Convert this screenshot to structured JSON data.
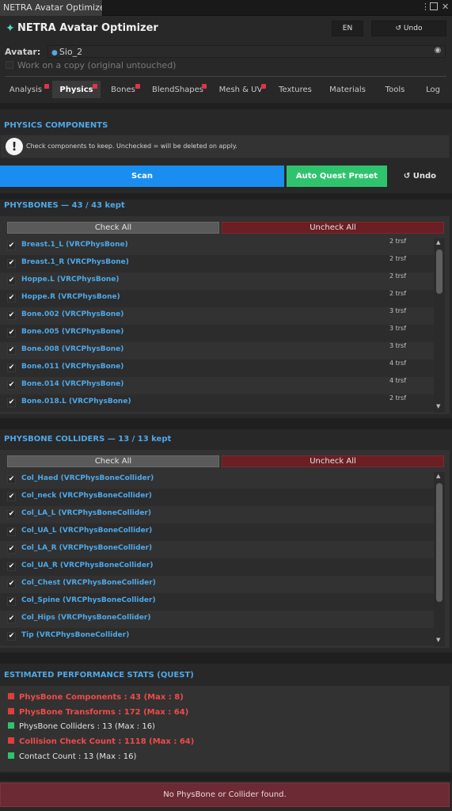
{
  "window": {
    "tab_title": "NETRA Avatar Optimizer"
  },
  "header": {
    "title": "NETRA Avatar Optimizer",
    "lang_label": "EN",
    "undo_label": "↺ Undo"
  },
  "avatar": {
    "label": "Avatar:",
    "value": "Sio_2",
    "copy_label": "Work on a copy (original untouched)"
  },
  "tabs": [
    {
      "label": "Analysis",
      "badge": true
    },
    {
      "label": "Physics",
      "badge": true,
      "active": true
    },
    {
      "label": "Bones",
      "badge": true
    },
    {
      "label": "BlendShapes",
      "badge": true
    },
    {
      "label": "Mesh & UV",
      "badge": true
    },
    {
      "label": "Textures",
      "badge": false
    },
    {
      "label": "Materials",
      "badge": false
    },
    {
      "label": "Tools",
      "badge": false
    },
    {
      "label": "Log",
      "badge": false
    }
  ],
  "physics": {
    "section_title": "PHYSICS COMPONENTS",
    "info_text": "Check components to keep. Unchecked = will be deleted on apply.",
    "scan_label": "Scan",
    "quest_label": "Auto Quest Preset",
    "undo_label": "↺ Undo"
  },
  "physbones": {
    "title": "PHYSBONES — 43 / 43 kept",
    "check_all": "Check All",
    "uncheck_all": "Uncheck All",
    "items": [
      {
        "label": "Breast.1_L  (VRCPhysBone)",
        "count": "2 trsf"
      },
      {
        "label": "Breast.1_R  (VRCPhysBone)",
        "count": "2 trsf"
      },
      {
        "label": "Hoppe.L  (VRCPhysBone)",
        "count": "2 trsf"
      },
      {
        "label": "Hoppe.R  (VRCPhysBone)",
        "count": "2 trsf"
      },
      {
        "label": "Bone.002  (VRCPhysBone)",
        "count": "3 trsf"
      },
      {
        "label": "Bone.005  (VRCPhysBone)",
        "count": "3 trsf"
      },
      {
        "label": "Bone.008  (VRCPhysBone)",
        "count": "3 trsf"
      },
      {
        "label": "Bone.011  (VRCPhysBone)",
        "count": "4 trsf"
      },
      {
        "label": "Bone.014  (VRCPhysBone)",
        "count": "4 trsf"
      },
      {
        "label": "Bone.018.L  (VRCPhysBone)",
        "count": "2 trsf"
      }
    ]
  },
  "colliders": {
    "title": "PHYSBONE COLLIDERS — 13 / 13 kept",
    "check_all": "Check All",
    "uncheck_all": "Uncheck All",
    "items": [
      {
        "label": "Col_Haed  (VRCPhysBoneCollider)"
      },
      {
        "label": "Col_neck  (VRCPhysBoneCollider)"
      },
      {
        "label": "Col_LA_L  (VRCPhysBoneCollider)"
      },
      {
        "label": "Col_UA_L  (VRCPhysBoneCollider)"
      },
      {
        "label": "Col_LA_R  (VRCPhysBoneCollider)"
      },
      {
        "label": "Col_UA_R  (VRCPhysBoneCollider)"
      },
      {
        "label": "Col_Chest  (VRCPhysBoneCollider)"
      },
      {
        "label": "Col_Spine  (VRCPhysBoneCollider)"
      },
      {
        "label": "Col_Hips  (VRCPhysBoneCollider)"
      },
      {
        "label": "Tip  (VRCPhysBoneCollider)"
      }
    ]
  },
  "stats": {
    "title": "ESTIMATED PERFORMANCE STATS (QUEST)",
    "items": [
      {
        "text": "PhysBone Components : 43  (Max : 8)",
        "status": "bad"
      },
      {
        "text": "PhysBone Transforms : 172  (Max : 64)",
        "status": "bad"
      },
      {
        "text": "PhysBone Colliders : 13  (Max : 16)",
        "status": "ok"
      },
      {
        "text": "Collision Check Count : 1118  (Max : 64)",
        "status": "bad"
      },
      {
        "text": "Contact Count : 13  (Max : 16)",
        "status": "ok"
      }
    ],
    "bad_color": "#e23c3c",
    "ok_color": "#2fc36e"
  },
  "footer": {
    "message": "No PhysBone or Collider found."
  }
}
